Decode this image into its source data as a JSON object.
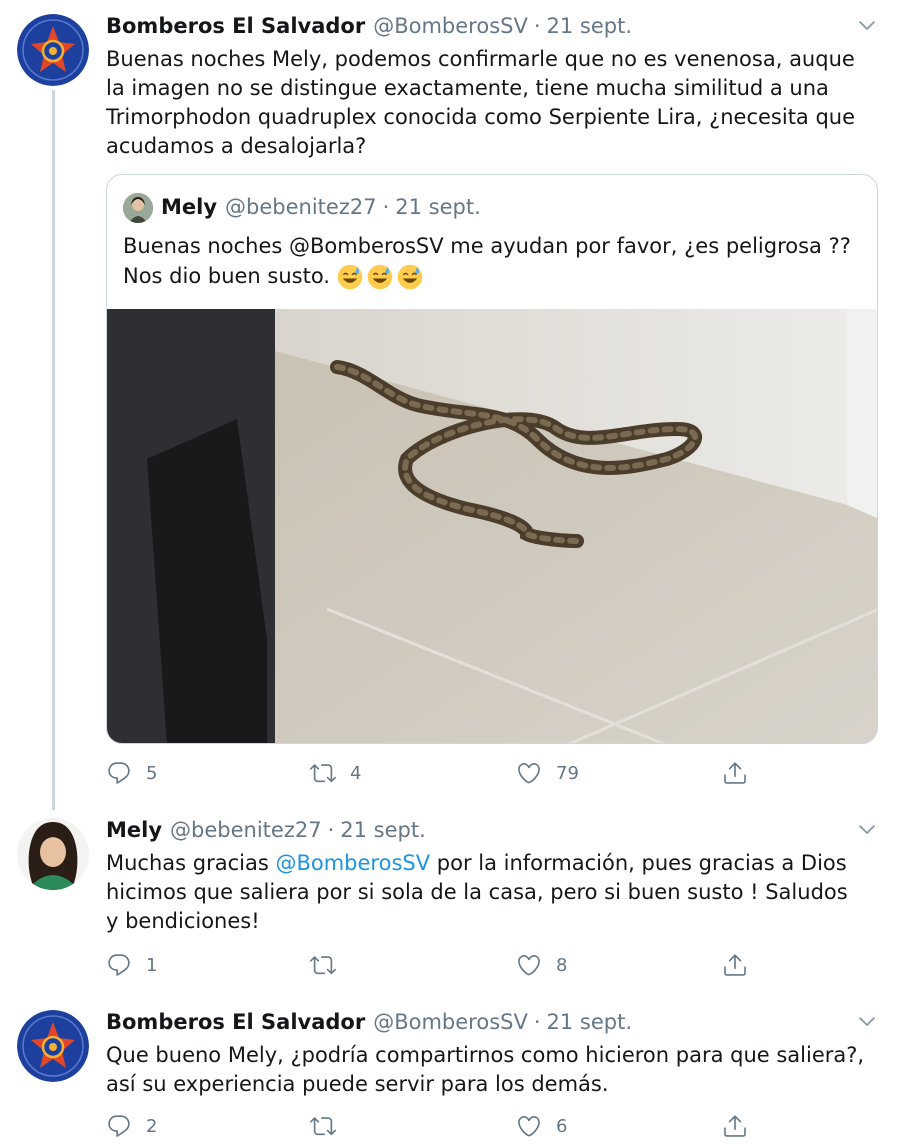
{
  "tweets": [
    {
      "author": "Bomberos El Salvador",
      "handle": "@BomberosSV",
      "date": "21 sept.",
      "text": "Buenas noches Mely, podemos confirmarle que no es venenosa, auque la imagen no se distingue exactamente, tiene mucha similitud a una Trimorphodon quadruplex conocida como Serpiente Lira, ¿necesita que acudamos a desalojarla?",
      "quote": {
        "author": "Mely",
        "handle": "@bebenitez27",
        "date": "21 sept.",
        "text_before_mention": "Buenas noches ",
        "mention": "@BomberosSV",
        "text_after_mention": " me ayudan por favor, ¿es peligrosa ?? Nos dio buen susto. ",
        "emoji": [
          "sweat-smile",
          "sweat-smile",
          "sweat-smile"
        ],
        "photo": "snake-on-floor-photo"
      },
      "replies": "5",
      "retweets": "4",
      "likes": "79"
    },
    {
      "author": "Mely",
      "handle": "@bebenitez27",
      "date": "21 sept.",
      "text_before_mention": "Muchas gracias ",
      "mention": "@BomberosSV",
      "text_after_mention": " por la información, pues gracias a Dios hicimos que saliera por si sola de la casa, pero si buen susto ! Saludos y bendiciones!",
      "replies": "1",
      "retweets": "",
      "likes": "8"
    },
    {
      "author": "Bomberos El Salvador",
      "handle": "@BomberosSV",
      "date": "21 sept.",
      "text": "Que bueno Mely, ¿podría compartirnos como hicieron para que saliera?, así su experiencia puede servir para los demás.",
      "replies": "2",
      "retweets": "",
      "likes": "6"
    }
  ],
  "separator": "·",
  "colors": {
    "text": "#14171a",
    "secondary": "#657786",
    "link": "#1b95e0",
    "border": "#ccd6dd"
  },
  "icons": [
    "chevron-down-icon",
    "reply-icon",
    "retweet-icon",
    "like-icon",
    "share-icon",
    "bomberos-logo"
  ]
}
